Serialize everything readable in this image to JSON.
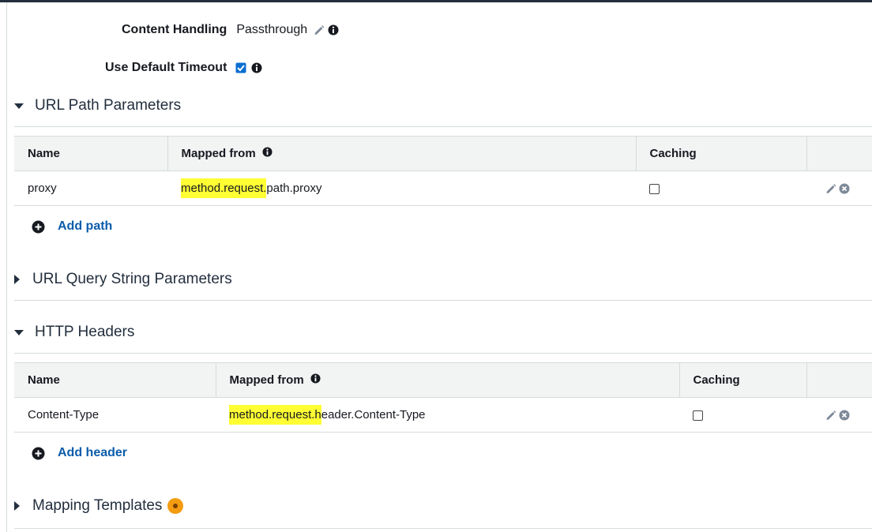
{
  "settings": {
    "content_handling": {
      "label": "Content Handling",
      "value": "Passthrough"
    },
    "default_timeout": {
      "label": "Use Default Timeout",
      "checked": true
    }
  },
  "url_path_params": {
    "title": "URL Path Parameters",
    "expanded": true,
    "columns": [
      "Name",
      "Mapped from",
      "Caching"
    ],
    "rows": [
      {
        "name": "proxy",
        "mapped_highlight": "method.request.",
        "mapped_rest": "path.proxy",
        "caching": false
      }
    ],
    "add_label": "Add path"
  },
  "url_query_params": {
    "title": "URL Query String Parameters",
    "expanded": false
  },
  "http_headers": {
    "title": "HTTP Headers",
    "expanded": true,
    "columns": [
      "Name",
      "Mapped from",
      "Caching"
    ],
    "rows": [
      {
        "name": "Content-Type",
        "mapped_highlight": "method.request.h",
        "mapped_rest": "eader.Content-Type",
        "caching": false
      }
    ],
    "add_label": "Add header"
  },
  "mapping_templates": {
    "title": "Mapping Templates",
    "expanded": false
  },
  "colors": {
    "link": "#0b5cab",
    "highlight": "#ffff33",
    "badge": "#f39c12",
    "header_bg": "#f2f3f3"
  }
}
